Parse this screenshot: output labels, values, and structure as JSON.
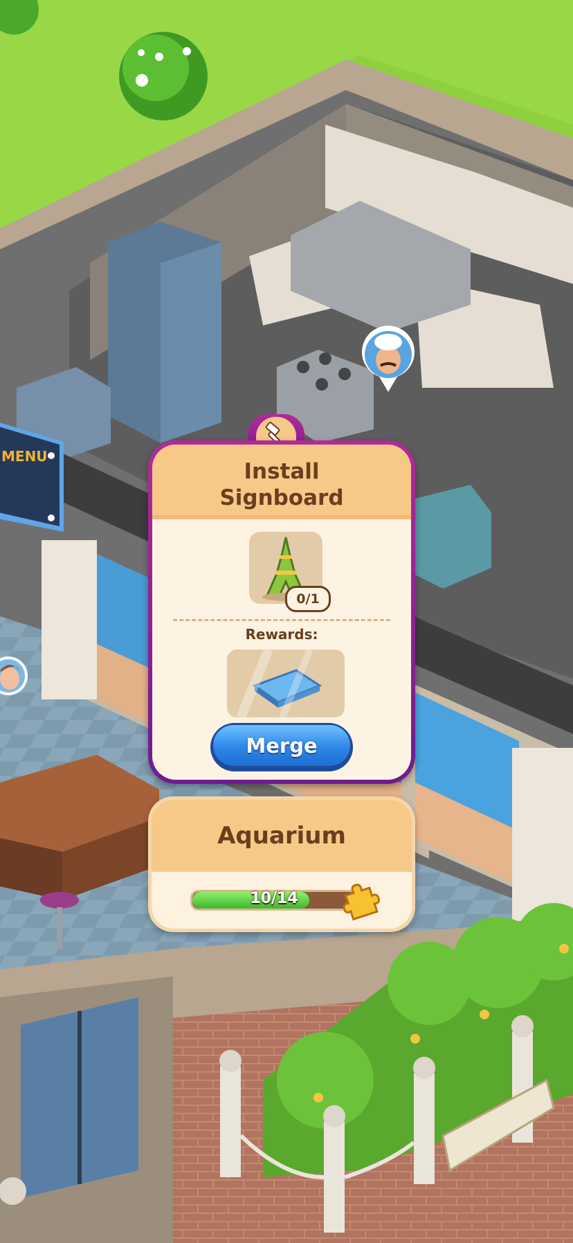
{
  "task_card": {
    "title_line1": "Install",
    "title_line2": "Signboard",
    "required_item": "eiffel-tower-icon",
    "required_progress": "0/1",
    "rewards_label": "Rewards:",
    "reward_item": "glass-panel-icon",
    "merge_button_label": "Merge"
  },
  "area_card": {
    "title": "Aquarium",
    "progress_text": "10/14",
    "progress_fraction": 0.714,
    "progress_icon": "puzzle-piece-icon"
  },
  "scene": {
    "menu_sign_text": "MENU",
    "chef_avatar": "chef-avatar-icon",
    "customer_avatar": "customer-avatar-icon"
  },
  "colors": {
    "card_border": "#b32a98",
    "card_header": "#f6c989",
    "text_brown": "#6a3f1e",
    "button_blue": "#2e86e6",
    "progress_green": "#3fb630"
  }
}
